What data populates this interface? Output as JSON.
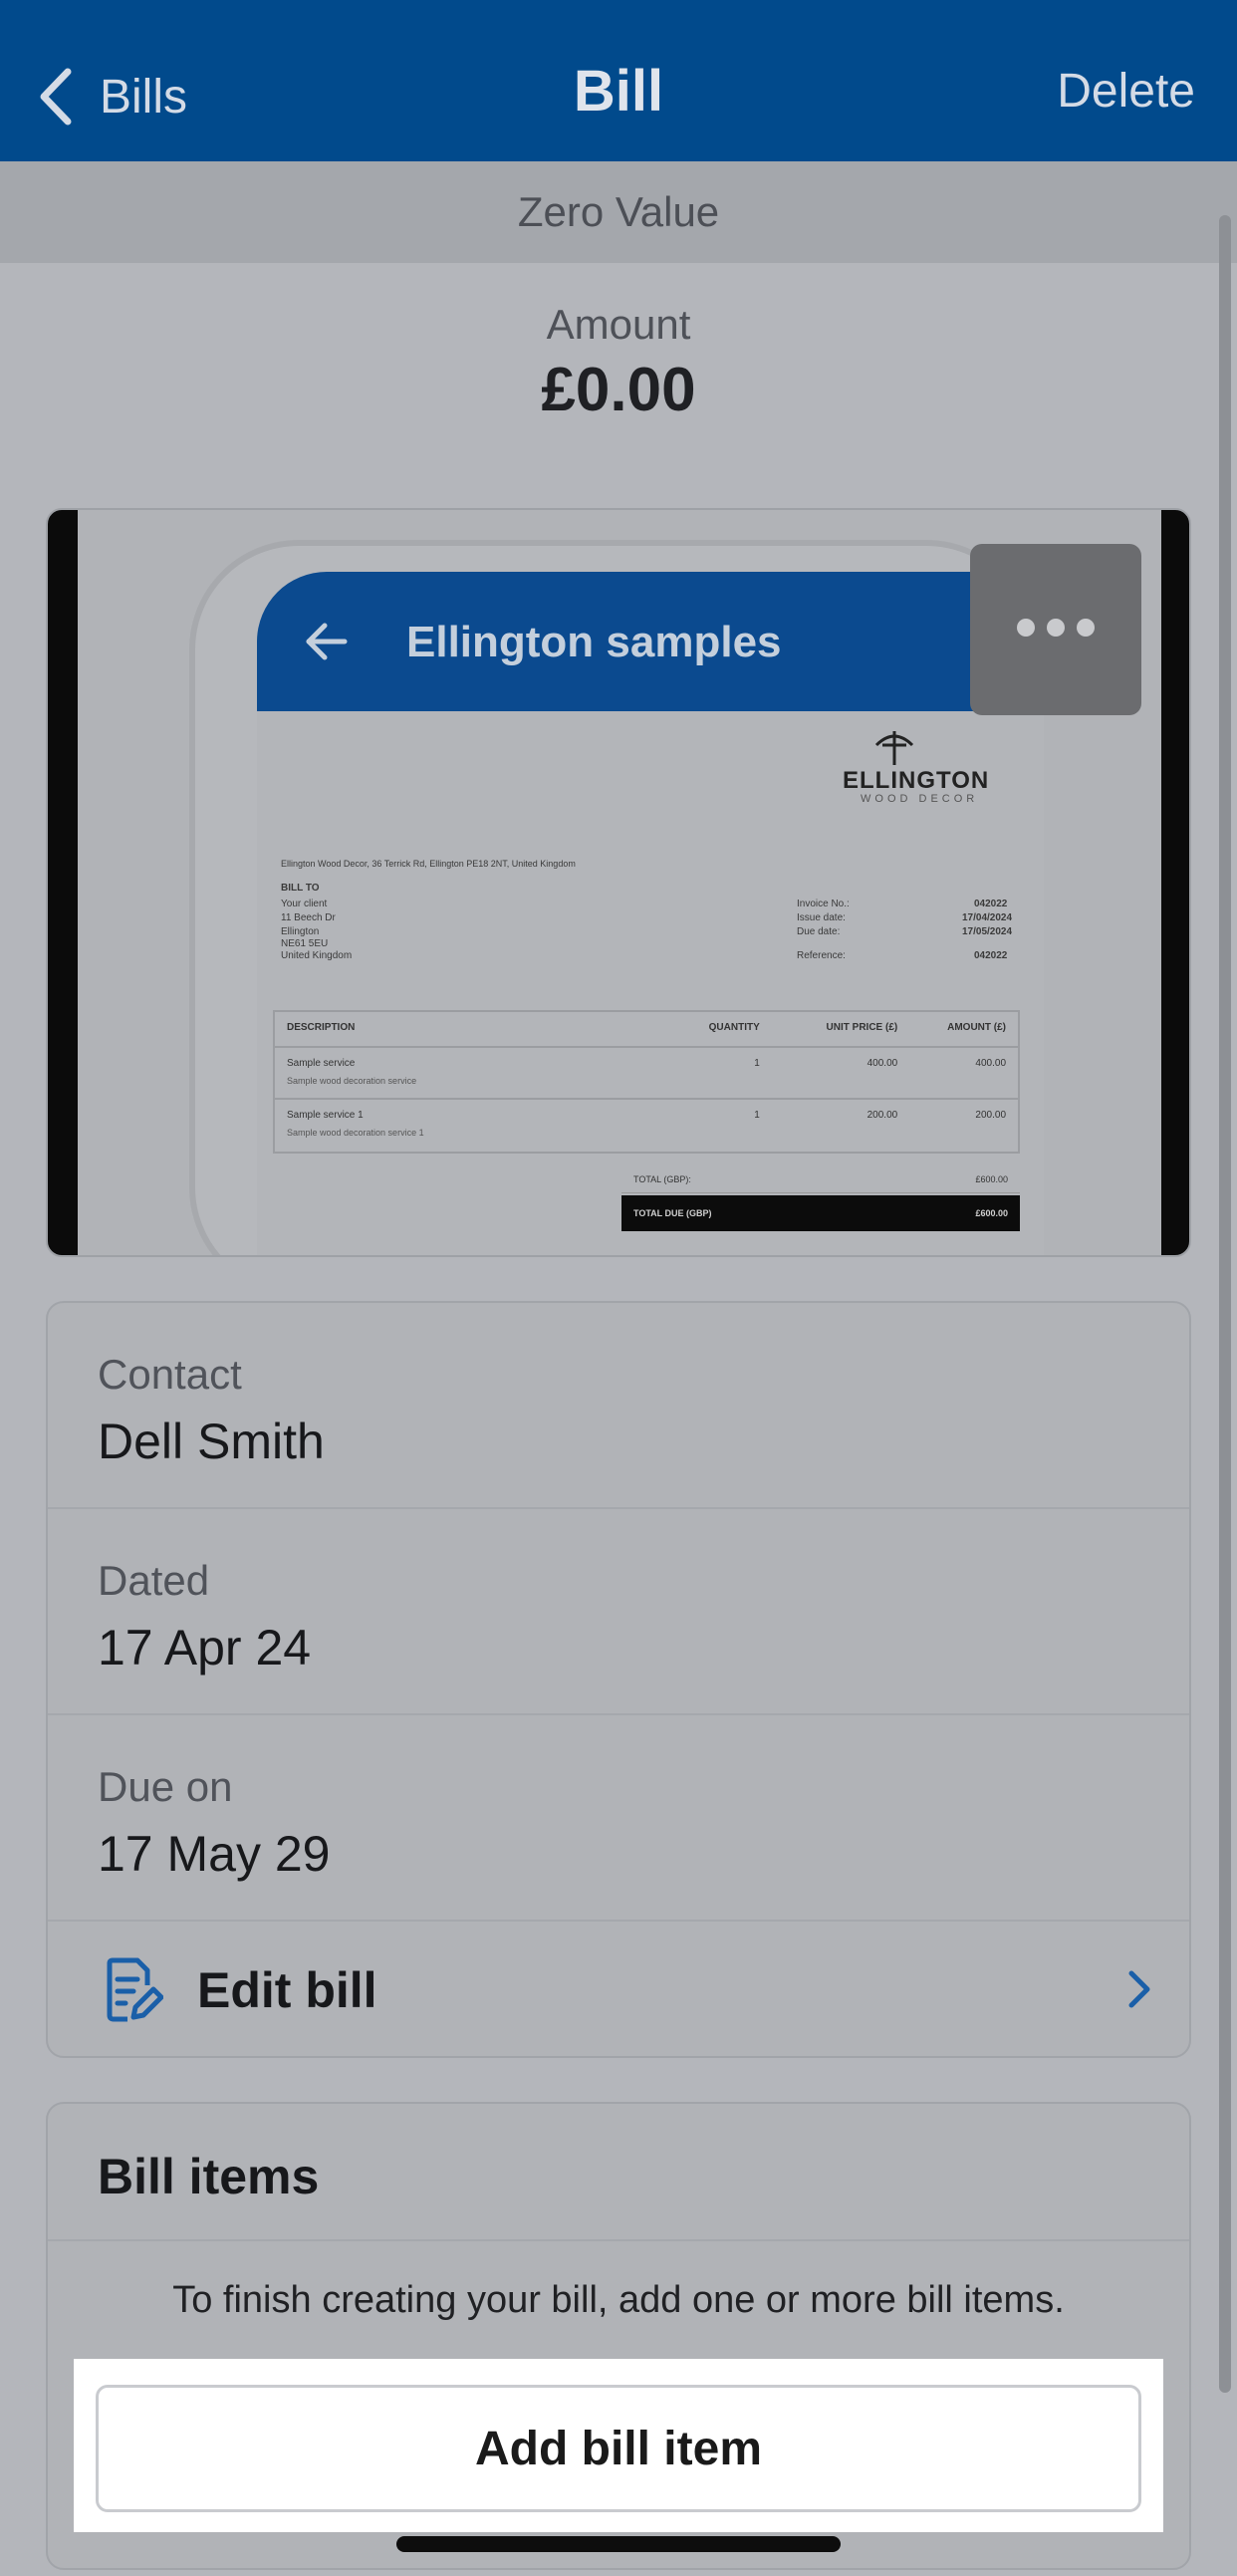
{
  "nav": {
    "back_label": "Bills",
    "title": "Bill",
    "delete_label": "Delete"
  },
  "status_banner": "Zero Value",
  "amount": {
    "label": "Amount",
    "value": "£0.00"
  },
  "attachment": {
    "preview_title": "Ellington samples",
    "logo_name": "ELLINGTON",
    "logo_sub": "WOOD DECOR",
    "from_line": "Ellington Wood Decor, 36 Terrick Rd, Ellington PE18 2NT, United Kingdom",
    "bill_to": {
      "heading": "BILL TO",
      "lines": [
        "Your client",
        "11 Beech Dr",
        "Ellington",
        "NE61 5EU",
        "United Kingdom"
      ]
    },
    "meta": [
      {
        "label": "Invoice No.:",
        "value": "042022"
      },
      {
        "label": "Issue date:",
        "value": "17/04/2024"
      },
      {
        "label": "Due date:",
        "value": "17/05/2024"
      },
      {
        "label": "Reference:",
        "value": "042022"
      }
    ],
    "table": {
      "headers": {
        "desc": "DESCRIPTION",
        "qty": "QUANTITY",
        "unit": "UNIT PRICE (£)",
        "amount": "AMOUNT (£)"
      },
      "rows": [
        {
          "desc": "Sample service",
          "sub": "Sample wood decoration service",
          "qty": "1",
          "unit": "400.00",
          "amount": "400.00"
        },
        {
          "desc": "Sample service 1",
          "sub": "Sample wood decoration service 1",
          "qty": "1",
          "unit": "200.00",
          "amount": "200.00"
        }
      ]
    },
    "total": {
      "label": "TOTAL (GBP):",
      "value": "£600.00"
    },
    "total_due": {
      "label": "TOTAL DUE (GBP)",
      "value": "£600.00"
    },
    "more_icon": "ellipsis-icon"
  },
  "details": {
    "contact": {
      "label": "Contact",
      "value": "Dell Smith"
    },
    "dated": {
      "label": "Dated",
      "value": "17 Apr 24"
    },
    "due_on": {
      "label": "Due on",
      "value": "17 May 29"
    },
    "edit_label": "Edit bill"
  },
  "bill_items": {
    "title": "Bill items",
    "hint": "To finish creating your bill, add one or more bill items.",
    "add_button": "Add bill item"
  },
  "colors": {
    "nav_blue": "#014a8c",
    "accent": "#1a5fa8"
  }
}
